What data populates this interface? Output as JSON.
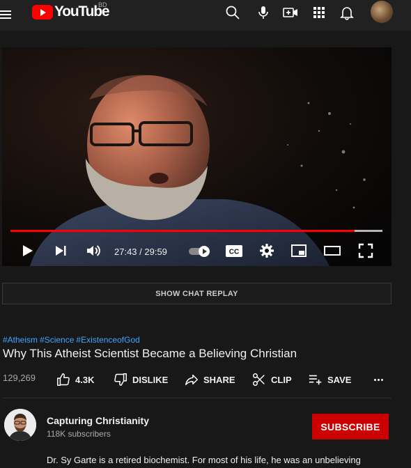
{
  "header": {
    "logo_text": "YouTube",
    "country_code": "BD",
    "icons": [
      "menu-icon",
      "search-icon",
      "microphone-icon",
      "create-video-icon",
      "apps-grid-icon",
      "notifications-bell-icon",
      "user-avatar"
    ]
  },
  "player": {
    "current_time": "27:43",
    "duration": "29:59",
    "time_display": "27:43 / 29:59",
    "progress_fraction": 0.9244,
    "buffered_fraction": 1.0,
    "controls": [
      "play-icon",
      "next-icon",
      "volume-icon",
      "autoplay-toggle",
      "captions-icon",
      "settings-gear-icon",
      "miniplayer-icon",
      "theater-mode-icon",
      "fullscreen-icon"
    ],
    "captions_label": "CC"
  },
  "chat_replay": {
    "label": "SHOW CHAT REPLAY"
  },
  "video": {
    "hashtags": [
      "#Atheism",
      "#Science",
      "#ExistenceofGod"
    ],
    "title": "Why This Atheist Scientist Became a Believing Christian",
    "views": "129,269"
  },
  "actions": {
    "like_count": "4.3K",
    "dislike_label": "DISLIKE",
    "share_label": "SHARE",
    "clip_label": "CLIP",
    "save_label": "SAVE"
  },
  "channel": {
    "name": "Capturing Christianity",
    "subscribers": "118K subscribers",
    "subscribe_label": "SUBSCRIBE"
  },
  "description": {
    "text": "Dr. Sy Garte is a retired biochemist. For most of his life, he was an unbelieving"
  },
  "colors": {
    "background": "#181818",
    "header": "#212121",
    "brand_red": "#ff0000",
    "subscribe_red": "#cc0000",
    "link_blue": "#3ea6ff",
    "secondary_text": "#aaaaaa"
  }
}
